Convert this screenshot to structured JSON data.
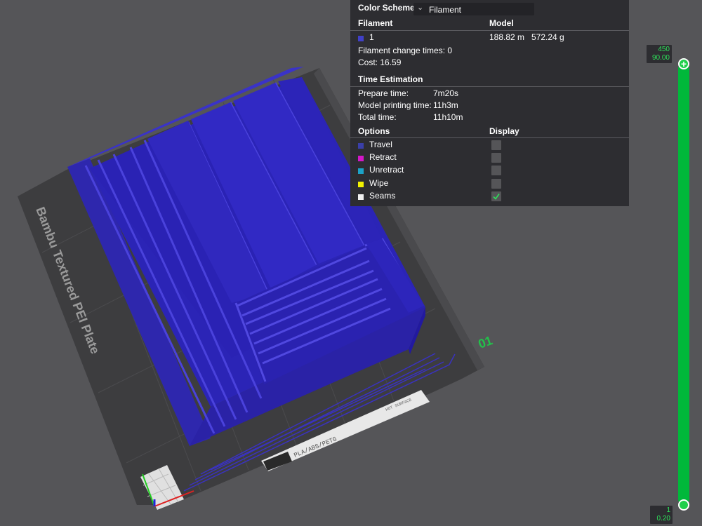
{
  "color_scheme": {
    "label": "Color Scheme",
    "selected": "Filament"
  },
  "filament_table": {
    "header_filament": "Filament",
    "header_model": "Model",
    "rows": [
      {
        "name": "1",
        "color": "#4040c8",
        "length": "188.82 m",
        "weight": "572.24 g"
      }
    ]
  },
  "filament_change": "Filament change times:  0",
  "cost": "Cost:  16.59",
  "time_estimation": {
    "title": "Time Estimation",
    "prepare_label": "Prepare time:",
    "prepare_value": "7m20s",
    "model_label": "Model printing time:",
    "model_value": "11h3m",
    "total_label": "Total time:",
    "total_value": "11h10m"
  },
  "options": {
    "header_options": "Options",
    "header_display": "Display",
    "items": [
      {
        "label": "Travel",
        "color": "#3a3fa8",
        "checked": false
      },
      {
        "label": "Retract",
        "color": "#d417c9",
        "checked": false
      },
      {
        "label": "Unretract",
        "color": "#1ca2c7",
        "checked": false
      },
      {
        "label": "Wipe",
        "color": "#f2f200",
        "checked": false
      },
      {
        "label": "Seams",
        "color": "#f0f0f0",
        "checked": true
      }
    ]
  },
  "plate": {
    "title": "Bambu Textured PEI Plate",
    "number": "01",
    "brand_label": "PLA/ABS/PETG",
    "hot_surface": "HOT SURFACE"
  },
  "slider": {
    "top_layer": "450",
    "top_height": "90.00",
    "bottom_layer": "1",
    "bottom_height": "0.20"
  },
  "colors": {
    "model": "#2c24b8",
    "accent_green": "#00b83a",
    "panel_bg": "#2d2d31"
  }
}
